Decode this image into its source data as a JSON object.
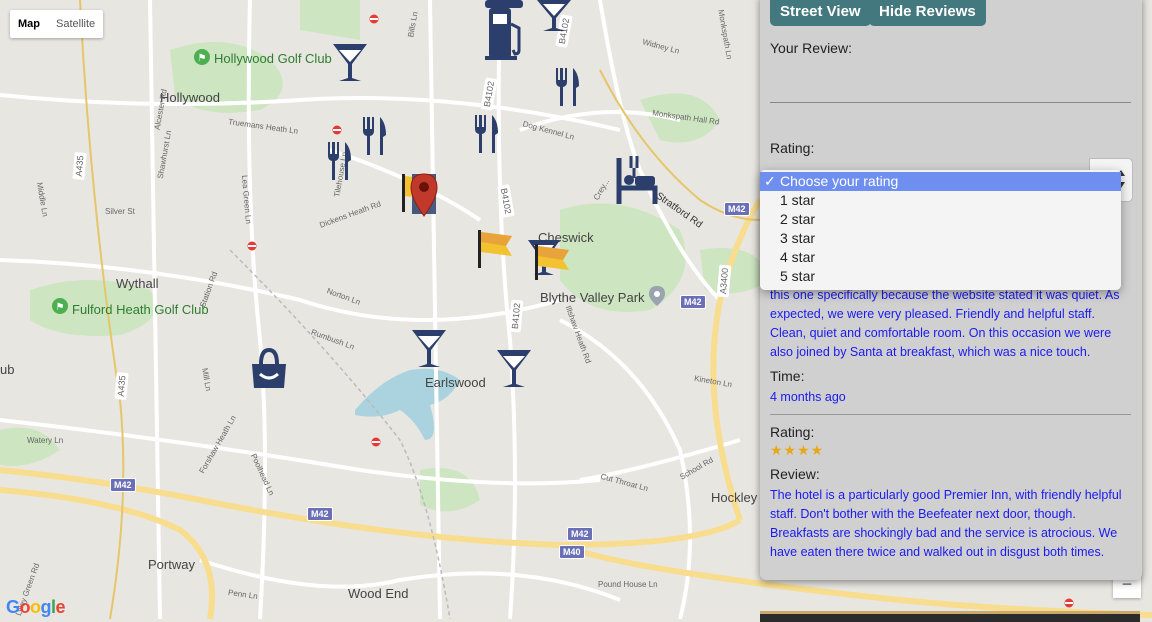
{
  "map_type": {
    "map": "Map",
    "satellite": "Satellite"
  },
  "places": {
    "hollywood_golf": "Hollywood Golf Club",
    "hollywood": "Hollywood",
    "wythall": "Wythall",
    "fulford": "Fulford Heath Golf Club",
    "earlswood": "Earlswood",
    "blythe": "Blythe Valley Park",
    "cheswick": "Cheswick",
    "portway": "Portway",
    "wood_end": "Wood End",
    "hockley": "Hockley",
    "ub": "ub"
  },
  "roads": {
    "r1": "Alcester Rd",
    "r2": "Truemans Heath Ln",
    "r3": "Shawhurst Ln",
    "r4": "Middle Ln",
    "r5": "Silver St",
    "r6": "Lea Green Ln",
    "r7": "Station Rd",
    "r8": "Norton Ln",
    "r9": "Rumbush Ln",
    "r10": "Mill Ln",
    "r11": "Watery Ln",
    "r12": "Forshaw Heath Ln",
    "r13": "Poolhead Ln",
    "r14": "Tilehouse Ln",
    "r15": "Dickens Heath Rd",
    "r16": "Bills Ln",
    "r17": "Dog Kennel Ln",
    "r18": "Monkspath Hall Rd",
    "r19": "Widney Ln",
    "r20": "Stratford Rd",
    "r21": "Kineton Ln",
    "r22": "School Rd",
    "r23": "Cut Throat Ln",
    "r24": "Pound House Ln",
    "r25": "Penn Ln",
    "r26": "Lilley Green Rd",
    "r27": "Illshaw Heath Rd",
    "r28": "Monkspath Ln",
    "r29": "Crey..."
  },
  "shields": {
    "a435": "A435",
    "a435b": "A435",
    "b4102": "B4102",
    "b4102b": "B4102",
    "b4102c": "B4102",
    "b4102d": "B4102",
    "m42a": "M42",
    "m42b": "M42",
    "m42c": "M42",
    "m42d": "M42",
    "m42e": "M42",
    "m40": "M40",
    "a3400": "A3400"
  },
  "google_logo": "Google",
  "zoom_out": "−",
  "panel": {
    "street_view": "Street View",
    "hide_reviews": "Hide Reviews",
    "your_review": "Your Review:",
    "rating_label": "Rating:",
    "dropdown": {
      "options": [
        "Choose your rating",
        "1 star",
        "2 star",
        "3 star",
        "4 star",
        "5 star"
      ],
      "selected": 0
    },
    "review1": {
      "text": "this one specifically because the website stated it was quiet. As expected, we were very pleased. Friendly and helpful staff. Clean, quiet and comfortable room. On this occasion we were also joined by Santa at breakfast, which was a nice touch.",
      "time_label": "Time:",
      "time": "4 months ago"
    },
    "review2": {
      "rating_label": "Rating:",
      "stars": "★★★★",
      "review_label": "Review:",
      "text": "The hotel is a particularly good Premier Inn, with friendly helpful staff. Don't bother with the Beefeater next door, though. Breakfasts are shockingly bad and the service is atrocious. We have eaten there twice and walked out in disgust both times."
    }
  },
  "colors": {
    "button": "#43787e",
    "link": "#1a1af0",
    "dropdown_selected": "#6e8ff0",
    "icon": "#2c3e6b",
    "star": "#e6a817"
  }
}
